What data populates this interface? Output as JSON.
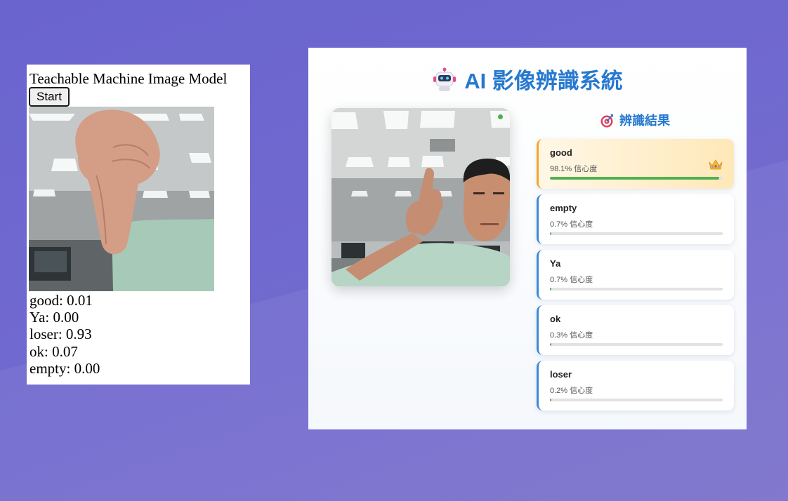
{
  "teachable": {
    "title": "Teachable Machine Image Model",
    "start_label": "Start",
    "predictions": [
      {
        "label": "good",
        "value": "0.01"
      },
      {
        "label": "Ya",
        "value": "0.00"
      },
      {
        "label": "loser",
        "value": "0.93"
      },
      {
        "label": "ok",
        "value": "0.07"
      },
      {
        "label": "empty",
        "value": "0.00"
      }
    ]
  },
  "app": {
    "title": "AI 影像辨識系統",
    "results_title": "辨識結果",
    "results": [
      {
        "label": "good",
        "confidence_text": "98.1% 信心度",
        "confidence": 0.981
      },
      {
        "label": "empty",
        "confidence_text": "0.7% 信心度",
        "confidence": 0.007
      },
      {
        "label": "Ya",
        "confidence_text": "0.7% 信心度",
        "confidence": 0.007
      },
      {
        "label": "ok",
        "confidence_text": "0.3% 信心度",
        "confidence": 0.003
      },
      {
        "label": "loser",
        "confidence_text": "0.2% 信心度",
        "confidence": 0.002
      }
    ]
  },
  "colors": {
    "accent": "#2679cf",
    "bar_fill": "#52b04f",
    "top_border": "#f4a629"
  },
  "icons": [
    "robot-icon",
    "target-icon",
    "crown-icon",
    "live-indicator-icon"
  ]
}
